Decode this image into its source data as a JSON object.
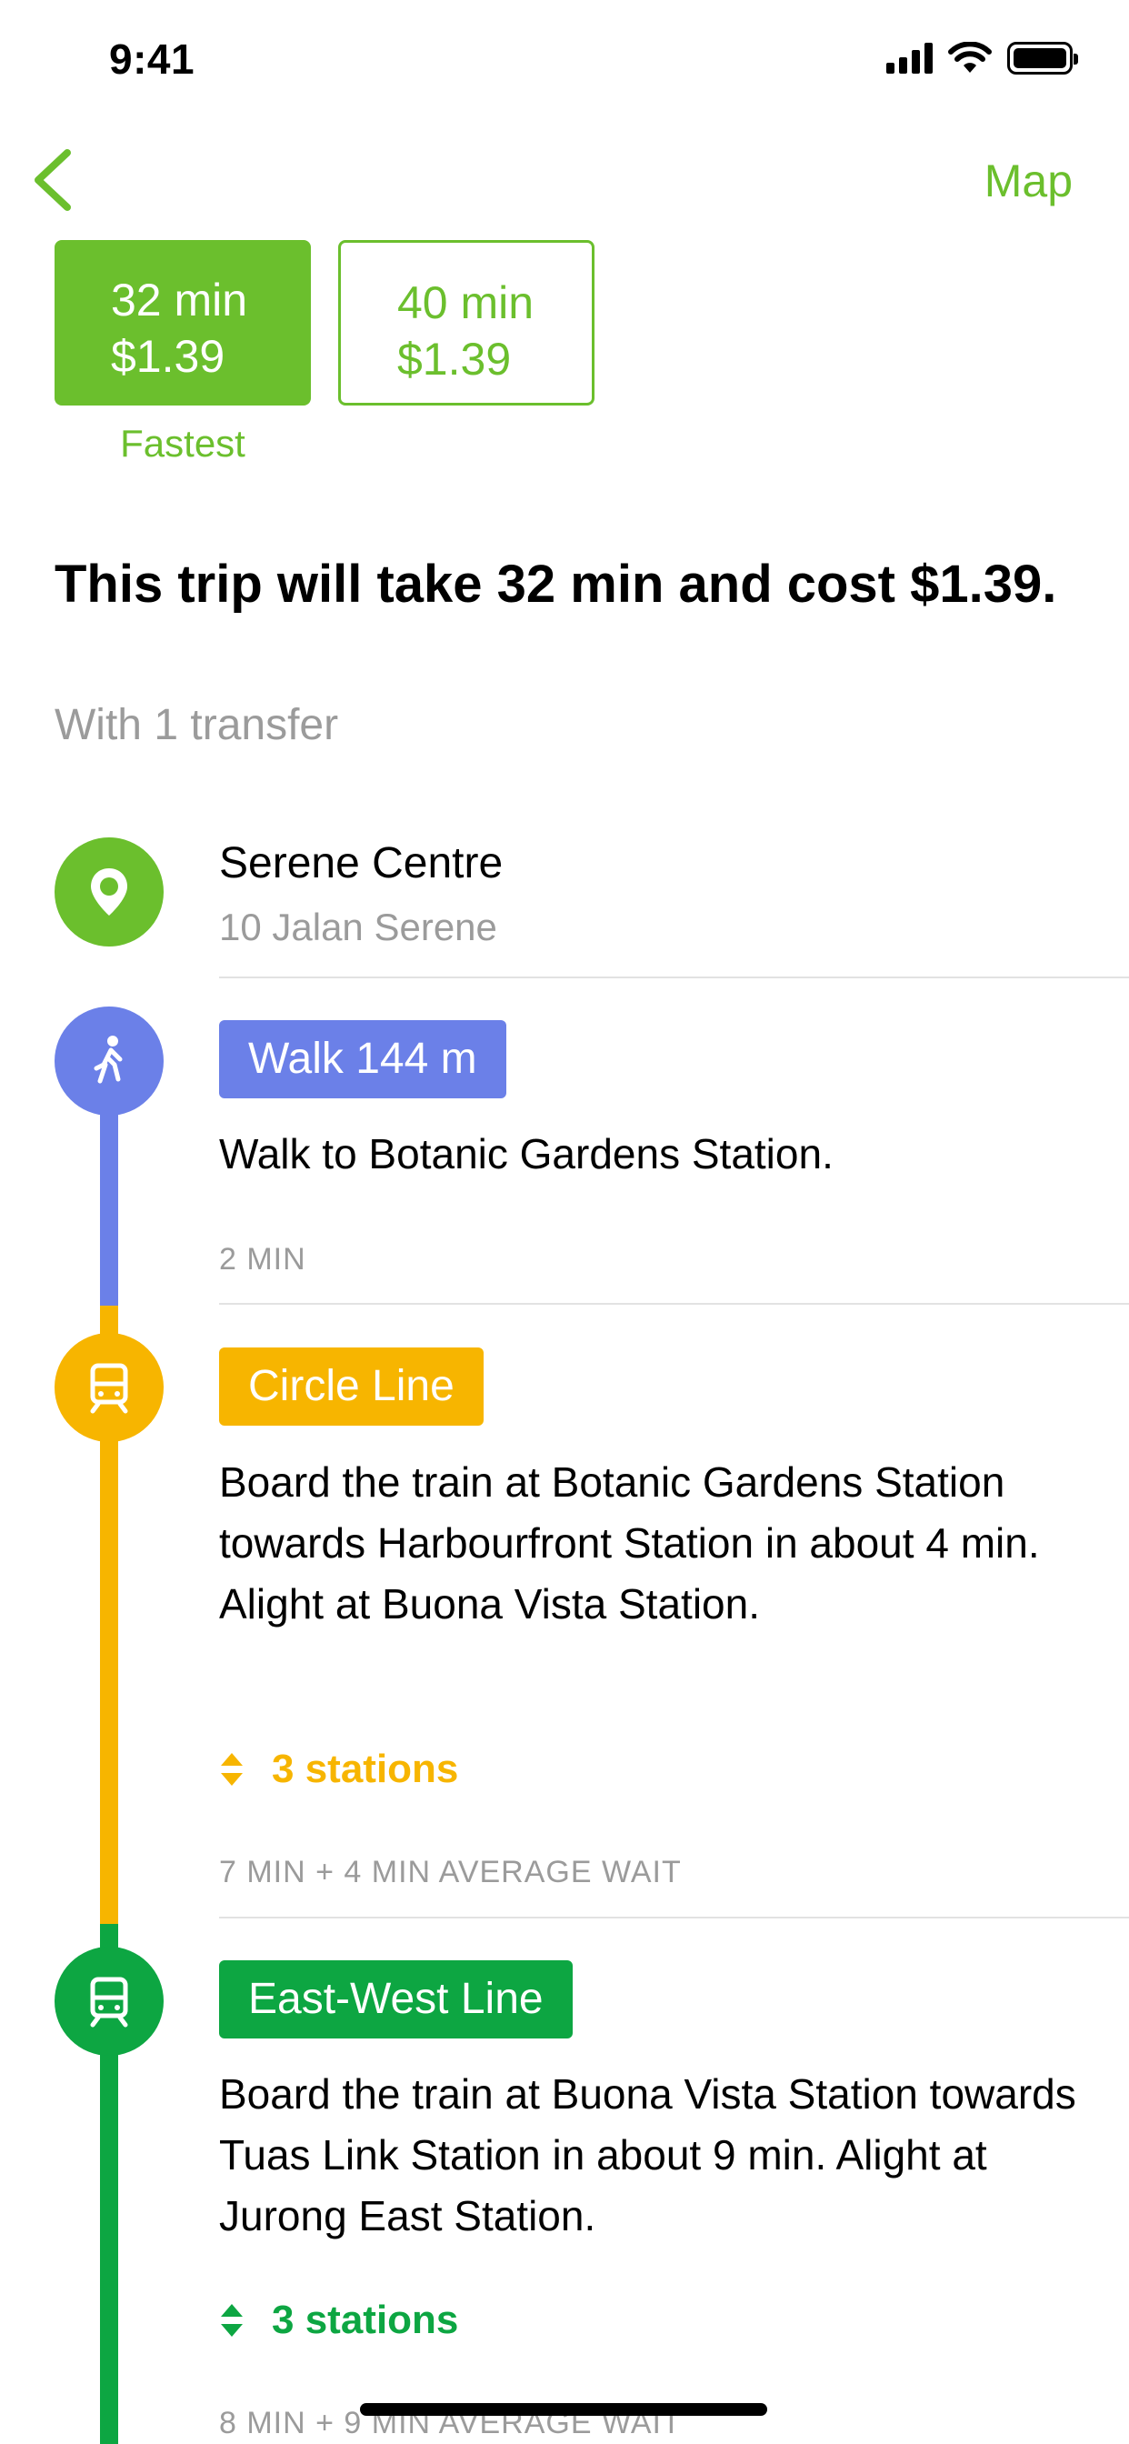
{
  "status_bar": {
    "time": "9:41"
  },
  "nav": {
    "map_label": "Map"
  },
  "options": [
    {
      "time": "32 min",
      "price": "$1.39",
      "tag": "Fastest"
    },
    {
      "time": "40 min",
      "price": "$1.39"
    }
  ],
  "summary": {
    "title": "This trip will take 32 min and cost $1.39.",
    "subtitle": "With 1 transfer"
  },
  "origin": {
    "name": "Serene Centre",
    "address": "10 Jalan Serene"
  },
  "steps": [
    {
      "badge": "Walk 144 m",
      "text": "Walk to Botanic Gardens Station.",
      "meta": "2 MIN",
      "color": "#6b80e8",
      "icon": "walk-icon"
    },
    {
      "badge": "Circle Line",
      "text": "Board the train at Botanic Gardens Station towards Harbourfront Station in about 4 min. Alight at Buona Vista Station.",
      "stations": "3 stations",
      "meta": "7 MIN + 4 MIN AVERAGE WAIT",
      "color": "#f7b500",
      "icon": "train-icon"
    },
    {
      "badge": "East-West Line",
      "text": "Board the train at Buona Vista Station towards Tuas Link Station in about 9 min. Alight at Jurong East Station.",
      "stations": "3 stations",
      "meta": "8 MIN + 9 MIN AVERAGE WAIT",
      "color": "#0da642",
      "icon": "train-icon"
    }
  ],
  "colors": {
    "accent": "#6bbf2d",
    "walk": "#6b80e8",
    "circle_line": "#f7b500",
    "east_west_line": "#0da642"
  }
}
